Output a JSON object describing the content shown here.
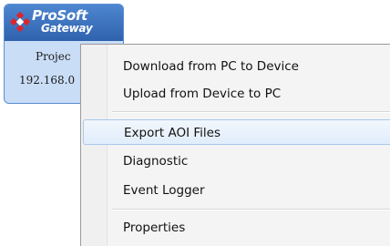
{
  "device": {
    "logo_line1": "ProSoft",
    "logo_line2": "Gateway",
    "project_label": "Projec",
    "ip_label": "192.168.0",
    "logo_icon": "prosoft-diamond-icon"
  },
  "context_menu": {
    "items": [
      {
        "label": "Download from PC to Device"
      },
      {
        "label": "Upload from Device to PC"
      },
      {
        "label": "Export AOI Files"
      },
      {
        "label": "Diagnostic"
      },
      {
        "label": "Event Logger"
      },
      {
        "label": "Properties"
      }
    ],
    "hovered_item": "Export AOI Files"
  },
  "colors": {
    "tile_header": "#2f62ad",
    "tile_body": "#c9ddf6",
    "logo_red": "#d9262e",
    "menu_background": "#f4f4f4",
    "hover_border": "#a8c8ec"
  }
}
